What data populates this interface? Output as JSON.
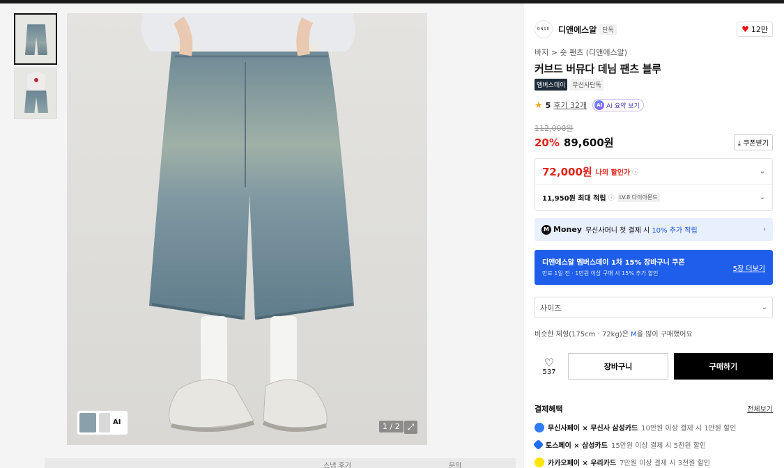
{
  "gallery": {
    "counter": "1 / 2",
    "ai_chip_label": "AI",
    "below": [
      "스냅 후기",
      "문의"
    ]
  },
  "product": {
    "brand": {
      "name": "디앤에스알",
      "logo_text": "DNSR",
      "tag": "단독"
    },
    "likes": "12만",
    "breadcrumb": "바지 > 숏 팬츠 (디앤에스알)",
    "title": "커브드 버뮤다 데님 팬츠 블루",
    "badges": [
      "멤버스데이",
      "무신사단독"
    ],
    "rating": "5",
    "review_link": "후기 32개",
    "ai_summary": "AI 요약 보기",
    "ai_logo": "AI",
    "original_price": "112,000원",
    "discount": "20%",
    "sale_price": "89,600원",
    "coupon_btn": "쿠폰받기",
    "my_price": "72,000원",
    "my_price_label": "나의 할인가",
    "points": "11,950원 최대 적립",
    "level": "LV.8 다이아몬드",
    "money": {
      "logo": "M",
      "word": "Money",
      "text": "무신사머니 첫 결제 시",
      "highlight": "10% 추가 적립"
    },
    "coupon_banner": {
      "title": "디앤에스알 멤버스데이 1차 15% 장바구니 쿠폰",
      "sub": "만료 1일 전 · 1만원 이상 구매 시 15% 추가 할인",
      "more": "5장 더보기"
    },
    "size_placeholder": "사이즈",
    "size_hint_before": "비슷한 체형(175cm · 72kg)은",
    "size_hint_size": "M",
    "size_hint_after": "을 많이 구매했어요",
    "wish_count": "537",
    "cart_label": "장바구니",
    "buy_label": "구매하기"
  },
  "payment": {
    "heading": "결제혜택",
    "view_all": "전체보기",
    "items": [
      {
        "name": "무신사페이 × 무신사 삼성카드",
        "desc": "10만원 이상 결제 시 1만원 할인",
        "color": "#2f7cf6"
      },
      {
        "name": "토스페이 × 삼성카드",
        "desc": "15만원 이상 결제 시 5천원 할인",
        "color": "#1e6ff5"
      },
      {
        "name": "카카오페이 × 우리카드",
        "desc": "7만원 이상 결제 시 3천원 할인",
        "color": "#fee500"
      }
    ]
  },
  "colors": {
    "accent_red": "#e0251b",
    "accent_blue": "#1f5eea",
    "buy_black": "#000000"
  }
}
